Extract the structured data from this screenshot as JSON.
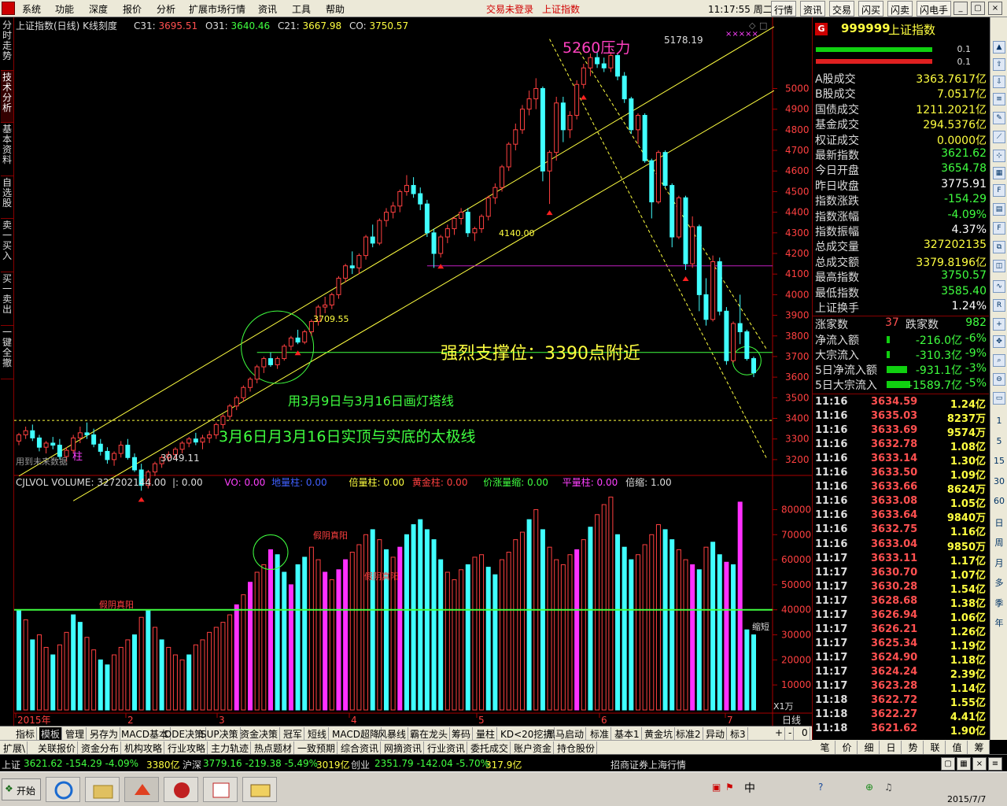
{
  "menubar": {
    "items": [
      "系统",
      "功能",
      "深度",
      "报价",
      "分析",
      "扩展市场行情",
      "资讯",
      "工具",
      "帮助"
    ],
    "status_trade": "交易未登录",
    "status_index": "上证指数",
    "clock": "11:17:55 周二",
    "buttons": [
      "行情",
      "资讯",
      "交易",
      "闪买",
      "闪卖",
      "闪电手"
    ]
  },
  "leftbar": {
    "tabs": [
      "分时走势",
      "技术分析",
      "基本资料",
      "自选股",
      "卖一买入",
      "买一卖出",
      "一键全撤"
    ]
  },
  "chart": {
    "header": {
      "title": "上证指数(日线) K线刻度",
      "c31_label": "C31: ",
      "c31": "3695.51",
      "o31_label": "O31: ",
      "o31": "3640.46",
      "c21_label": "C21: ",
      "c21": "3667.98",
      "co_label": "CO: ",
      "co": "3750.57"
    },
    "price_ticks": [
      "5000",
      "4900",
      "4800",
      "4700",
      "4600",
      "4500",
      "4400",
      "4300",
      "4200",
      "4100",
      "4000",
      "3900",
      "3800",
      "3700",
      "3600",
      "3500",
      "3400",
      "3300",
      "3200"
    ],
    "annotations": {
      "pressure": "5260压力",
      "high": "5178.19",
      "low": "3049.11",
      "mid_low": "4140.00",
      "circle_label": "3709.55",
      "support": "强烈支撑位：3390点附近",
      "line1": "用3月9日与3月16日画灯塔线",
      "line2": "3月6日月3月16日实顶与实底的太极线",
      "future_data": "用到未来数据",
      "pillar": "柱",
      "markers": "×××××"
    },
    "chart_data": {
      "type": "candlestick",
      "x_labels": [
        "2015年",
        "2",
        "3",
        "4",
        "5",
        "6",
        "7"
      ],
      "ylim": [
        3150,
        5250
      ],
      "candles": [
        [
          3290,
          3330,
          3270,
          3320
        ],
        [
          3320,
          3360,
          3300,
          3340
        ],
        [
          3340,
          3370,
          3290,
          3305
        ],
        [
          3305,
          3320,
          3240,
          3260
        ],
        [
          3260,
          3290,
          3230,
          3280
        ],
        [
          3280,
          3310,
          3250,
          3270
        ],
        [
          3270,
          3300,
          3200,
          3215
        ],
        [
          3215,
          3260,
          3190,
          3245
        ],
        [
          3245,
          3320,
          3230,
          3305
        ],
        [
          3305,
          3360,
          3280,
          3330
        ],
        [
          3330,
          3380,
          3300,
          3320
        ],
        [
          3320,
          3350,
          3260,
          3275
        ],
        [
          3275,
          3300,
          3220,
          3240
        ],
        [
          3240,
          3260,
          3180,
          3200
        ],
        [
          3200,
          3240,
          3170,
          3230
        ],
        [
          3230,
          3290,
          3210,
          3270
        ],
        [
          3270,
          3300,
          3200,
          3210
        ],
        [
          3210,
          3230,
          3140,
          3150
        ],
        [
          3150,
          3180,
          3049,
          3075
        ],
        [
          3075,
          3150,
          3060,
          3140
        ],
        [
          3140,
          3190,
          3120,
          3180
        ],
        [
          3180,
          3220,
          3160,
          3210
        ],
        [
          3210,
          3240,
          3190,
          3225
        ],
        [
          3225,
          3260,
          3200,
          3250
        ],
        [
          3250,
          3290,
          3230,
          3280
        ],
        [
          3280,
          3310,
          3260,
          3300
        ],
        [
          3300,
          3330,
          3270,
          3285
        ],
        [
          3285,
          3320,
          3250,
          3305
        ],
        [
          3305,
          3340,
          3280,
          3320
        ],
        [
          3320,
          3380,
          3300,
          3370
        ],
        [
          3370,
          3420,
          3350,
          3410
        ],
        [
          3410,
          3470,
          3390,
          3460
        ],
        [
          3460,
          3510,
          3440,
          3500
        ],
        [
          3500,
          3560,
          3480,
          3550
        ],
        [
          3550,
          3600,
          3530,
          3590
        ],
        [
          3590,
          3660,
          3570,
          3650
        ],
        [
          3650,
          3700,
          3620,
          3690
        ],
        [
          3690,
          3720,
          3650,
          3660
        ],
        [
          3660,
          3700,
          3640,
          3690
        ],
        [
          3690,
          3760,
          3680,
          3750
        ],
        [
          3750,
          3800,
          3730,
          3790
        ],
        [
          3790,
          3830,
          3760,
          3770
        ],
        [
          3770,
          3830,
          3760,
          3820
        ],
        [
          3820,
          3880,
          3800,
          3870
        ],
        [
          3870,
          3950,
          3850,
          3940
        ],
        [
          3940,
          3990,
          3910,
          3950
        ],
        [
          3950,
          4010,
          3930,
          4000
        ],
        [
          4000,
          4090,
          3980,
          4080
        ],
        [
          4080,
          4150,
          4060,
          4140
        ],
        [
          4140,
          4210,
          4100,
          4130
        ],
        [
          4130,
          4200,
          4100,
          4190
        ],
        [
          4190,
          4290,
          4170,
          4280
        ],
        [
          4280,
          4340,
          4230,
          4250
        ],
        [
          4250,
          4370,
          4240,
          4360
        ],
        [
          4360,
          4420,
          4330,
          4400
        ],
        [
          4400,
          4450,
          4370,
          4430
        ],
        [
          4430,
          4510,
          4400,
          4500
        ],
        [
          4500,
          4580,
          4480,
          4530
        ],
        [
          4530,
          4570,
          4470,
          4490
        ],
        [
          4490,
          4520,
          4410,
          4440
        ],
        [
          4440,
          4460,
          4280,
          4300
        ],
        [
          4300,
          4320,
          4130,
          4200
        ],
        [
          4200,
          4290,
          4180,
          4280
        ],
        [
          4280,
          4340,
          4250,
          4320
        ],
        [
          4320,
          4380,
          4290,
          4370
        ],
        [
          4370,
          4420,
          4340,
          4400
        ],
        [
          4400,
          4420,
          4280,
          4300
        ],
        [
          4300,
          4330,
          4260,
          4320
        ],
        [
          4320,
          4390,
          4300,
          4380
        ],
        [
          4380,
          4480,
          4360,
          4470
        ],
        [
          4470,
          4540,
          4440,
          4520
        ],
        [
          4520,
          4630,
          4500,
          4620
        ],
        [
          4620,
          4740,
          4600,
          4730
        ],
        [
          4730,
          4830,
          4700,
          4800
        ],
        [
          4800,
          4920,
          4780,
          4900
        ],
        [
          4900,
          4990,
          4870,
          4950
        ],
        [
          4950,
          5050,
          4900,
          5000
        ],
        [
          5000,
          5010,
          4550,
          4600
        ],
        [
          4600,
          4700,
          4440,
          4690
        ],
        [
          4690,
          4960,
          4650,
          4930
        ],
        [
          4930,
          4960,
          4740,
          4800
        ],
        [
          4800,
          4890,
          4760,
          4870
        ],
        [
          4870,
          5040,
          4850,
          5020
        ],
        [
          5020,
          5120,
          5000,
          5100
        ],
        [
          5100,
          5170,
          5060,
          5150
        ],
        [
          5150,
          5178,
          5100,
          5120
        ],
        [
          5120,
          5150,
          5080,
          5100
        ],
        [
          5100,
          5178,
          5080,
          5160
        ],
        [
          5160,
          5170,
          5040,
          5060
        ],
        [
          5060,
          5080,
          4930,
          4950
        ],
        [
          4950,
          4960,
          4780,
          4800
        ],
        [
          4800,
          4880,
          4730,
          4870
        ],
        [
          4870,
          4880,
          4640,
          4650
        ],
        [
          4650,
          4660,
          4370,
          4450
        ],
        [
          4450,
          4700,
          4440,
          4690
        ],
        [
          4690,
          4700,
          4520,
          4530
        ],
        [
          4530,
          4540,
          4230,
          4280
        ],
        [
          4280,
          4480,
          4270,
          4470
        ],
        [
          4470,
          4480,
          4120,
          4150
        ],
        [
          4150,
          4380,
          4130,
          4330
        ],
        [
          4330,
          4340,
          3920,
          4000
        ],
        [
          4000,
          4080,
          3850,
          3880
        ],
        [
          3880,
          4190,
          3870,
          4160
        ],
        [
          4160,
          4180,
          3900,
          3920
        ],
        [
          3920,
          3940,
          3660,
          3680
        ],
        [
          3680,
          3870,
          3670,
          3860
        ],
        [
          3860,
          4000,
          3760,
          3820
        ],
        [
          3820,
          3830,
          3680,
          3690
        ],
        [
          3690,
          3700,
          3600,
          3621
        ]
      ]
    }
  },
  "volume": {
    "header": {
      "title": "CJLVOL VOLUME: ",
      "value": "327202144.00",
      "sep": "|: 0.00",
      "vo": "VO: 0.00",
      "dlz": "地量柱: 0.00",
      "blz": "倍量柱: 0.00",
      "hjz": "黄金柱: 0.00",
      "jzlj": "价涨量缩: 0.00",
      "plz": "平量柱: 0.00",
      "bs": "倍缩: 1.00"
    },
    "ticks": [
      "80000",
      "70000",
      "60000",
      "50000",
      "40000",
      "30000",
      "20000",
      "10000"
    ],
    "unit": "X1万",
    "labels": {
      "a": "假阴真阳",
      "b": "假阴真阳",
      "c": "假阴真阳",
      "d": "缩短"
    },
    "chart_data": {
      "type": "bar",
      "ylim": [
        0,
        88000
      ],
      "values": [
        40000,
        36000,
        28000,
        30000,
        25000,
        22000,
        26000,
        31000,
        38000,
        35000,
        29000,
        24000,
        20000,
        18000,
        22000,
        25000,
        28000,
        30000,
        37000,
        40000,
        33000,
        28000,
        25000,
        22000,
        20000,
        22000,
        26000,
        28000,
        31000,
        33000,
        35000,
        38000,
        42000,
        46000,
        51000,
        55000,
        58000,
        64000,
        62000,
        55000,
        50000,
        58000,
        61000,
        65000,
        60000,
        55000,
        52000,
        56000,
        60000,
        63000,
        66000,
        70000,
        72000,
        68000,
        64000,
        61000,
        65000,
        70000,
        74000,
        76000,
        72000,
        68000,
        60000,
        55000,
        52000,
        56000,
        58000,
        61000,
        62000,
        57000,
        54000,
        60000,
        63000,
        68000,
        71000,
        76000,
        80000,
        72000,
        65000,
        60000,
        58000,
        62000,
        64000,
        68000,
        73000,
        78000,
        82000,
        85000,
        70000,
        65000,
        60000,
        62000,
        66000,
        70000,
        74000,
        72000,
        68000,
        64000,
        60000,
        58000,
        56000,
        65000,
        67000,
        62000,
        59000,
        58000,
        83000,
        32000,
        30000
      ],
      "colors": [
        "c",
        "r",
        "c",
        "r",
        "r",
        "c",
        "r",
        "r",
        "c",
        "c",
        "r",
        "r",
        "c",
        "c",
        "r",
        "r",
        "r",
        "c",
        "r",
        "c",
        "r",
        "c",
        "r",
        "r",
        "r",
        "c",
        "r",
        "r",
        "r",
        "r",
        "r",
        "r",
        "m",
        "r",
        "m",
        "r",
        "r",
        "m",
        "c",
        "c",
        "m",
        "c",
        "c",
        "r",
        "r",
        "m",
        "r",
        "m",
        "m",
        "r",
        "r",
        "r",
        "c",
        "r",
        "c",
        "r",
        "m",
        "c",
        "c",
        "c",
        "c",
        "c",
        "c",
        "r",
        "r",
        "r",
        "c",
        "r",
        "r",
        "c",
        "c",
        "r",
        "r",
        "r",
        "r",
        "c",
        "r",
        "c",
        "r",
        "r",
        "r",
        "r",
        "m",
        "r",
        "c",
        "r",
        "r",
        "r",
        "c",
        "c",
        "c",
        "r",
        "r",
        "r",
        "r",
        "c",
        "c",
        "r",
        "r",
        "m",
        "c",
        "r",
        "c",
        "c",
        "m",
        "c",
        "m",
        "c",
        "c"
      ]
    }
  },
  "right_panel": {
    "code": "999999",
    "name": "上证指数",
    "bars": [
      "0.1",
      "0.1"
    ],
    "stats": [
      {
        "k": "A股成交",
        "v": "3363.7617亿",
        "c": "#ffff40"
      },
      {
        "k": "B股成交",
        "v": "7.0517亿",
        "c": "#ffff40"
      },
      {
        "k": "国债成交",
        "v": "1211.2021亿",
        "c": "#ffff40"
      },
      {
        "k": "基金成交",
        "v": "294.5376亿",
        "c": "#ffff40"
      },
      {
        "k": "权证成交",
        "v": "0.0000亿",
        "c": "#ffff40"
      },
      {
        "k": "最新指数",
        "v": "3621.62",
        "c": "#40ff40"
      },
      {
        "k": "今日开盘",
        "v": "3654.78",
        "c": "#40ff40"
      },
      {
        "k": "昨日收盘",
        "v": "3775.91",
        "c": "#ffffff"
      },
      {
        "k": "指数涨跌",
        "v": "-154.29",
        "c": "#40ff40"
      },
      {
        "k": "指数涨幅",
        "v": "-4.09%",
        "c": "#40ff40"
      },
      {
        "k": "指数振幅",
        "v": "4.37%",
        "c": "#ffffff"
      },
      {
        "k": "总成交量",
        "v": "327202135",
        "c": "#ffff40"
      },
      {
        "k": "总成交额",
        "v": "3379.8196亿",
        "c": "#ffff40"
      },
      {
        "k": "最高指数",
        "v": "3750.57",
        "c": "#40ff40"
      },
      {
        "k": "最低指数",
        "v": "3585.40",
        "c": "#40ff40"
      },
      {
        "k": "上证换手",
        "v": "1.24%",
        "c": "#ffffff"
      }
    ],
    "up_label": "涨家数",
    "up": "37",
    "down_label": "跌家数",
    "down": "982",
    "flows": [
      {
        "k": "净流入额",
        "v": "-216.0亿",
        "p": "-6%"
      },
      {
        "k": "大宗流入",
        "v": "-310.3亿",
        "p": "-9%"
      },
      {
        "k": "5日净流入额",
        "v": "-931.1亿",
        "p": "-3%"
      },
      {
        "k": "5日大宗流入",
        "v": "-1589.7亿",
        "p": "-5%"
      }
    ],
    "ticks": [
      [
        "11:16",
        "3634.59",
        "1.24亿"
      ],
      [
        "11:16",
        "3635.03",
        "8237万"
      ],
      [
        "11:16",
        "3633.69",
        "9574万"
      ],
      [
        "11:16",
        "3632.78",
        "1.08亿"
      ],
      [
        "11:16",
        "3633.14",
        "1.30亿"
      ],
      [
        "11:16",
        "3633.50",
        "1.09亿"
      ],
      [
        "11:16",
        "3633.66",
        "8624万"
      ],
      [
        "11:16",
        "3633.08",
        "1.05亿"
      ],
      [
        "11:16",
        "3633.64",
        "9840万"
      ],
      [
        "11:16",
        "3632.75",
        "1.16亿"
      ],
      [
        "11:16",
        "3633.04",
        "9850万"
      ],
      [
        "11:17",
        "3633.11",
        "1.17亿"
      ],
      [
        "11:17",
        "3630.70",
        "1.07亿"
      ],
      [
        "11:17",
        "3630.28",
        "1.54亿"
      ],
      [
        "11:17",
        "3628.68",
        "1.38亿"
      ],
      [
        "11:17",
        "3626.94",
        "1.06亿"
      ],
      [
        "11:17",
        "3626.21",
        "1.26亿"
      ],
      [
        "11:17",
        "3625.34",
        "1.19亿"
      ],
      [
        "11:17",
        "3624.90",
        "1.18亿"
      ],
      [
        "11:17",
        "3624.24",
        "2.39亿"
      ],
      [
        "11:17",
        "3623.28",
        "1.14亿"
      ],
      [
        "11:18",
        "3622.72",
        "1.55亿"
      ],
      [
        "11:18",
        "3622.27",
        "4.41亿"
      ],
      [
        "11:18",
        "3621.62",
        "1.90亿"
      ]
    ],
    "tabs": [
      "笔",
      "价",
      "细",
      "日",
      "势",
      "联",
      "值",
      "筹"
    ]
  },
  "right_tools": {
    "labels": [
      "1",
      "5",
      "15",
      "30",
      "60",
      "日",
      "周",
      "月",
      "多",
      "季",
      "年"
    ]
  },
  "tabs1": [
    "指标",
    "模板",
    "管理",
    "另存为",
    "MACD基本",
    "DDE决策",
    "SUP决策",
    "资金决策",
    "冠军",
    "短线",
    "MACD超降",
    "风暴线",
    "霸在龙头",
    "筹码",
    "量柱",
    "KD<20挖抗",
    "黑马启动",
    "标准",
    "基本1",
    "黄金坑",
    "标准2",
    "异动",
    "标3"
  ],
  "tabs1_right": [
    "+",
    "-",
    "0"
  ],
  "tabs2": [
    "扩展\\",
    "关联报价",
    "资金分布",
    "机构攻略",
    "行业攻略",
    "主力轨迹",
    "热点题材",
    "一致预期",
    "综合资讯",
    "网摘资讯",
    "行业资讯",
    "委托成交",
    "账户资金",
    "持仓股份"
  ],
  "daily_label": "日线",
  "statusbar": {
    "sh_label": "上证",
    "sh": "3621.62 -154.29 -4.09%",
    "sh_amt": "3380亿",
    "hs_label": "沪深",
    "hs": "3779.16 -219.38 -5.49%",
    "hs_amt": "3019亿",
    "cy_label": "创业",
    "cy": "2351.79 -142.04 -5.70%",
    "cy_amt": "317.9亿",
    "broker": "招商证券上海行情"
  },
  "taskbar": {
    "start": "开始",
    "tray_text": "中",
    "date": "2015/7/7"
  }
}
